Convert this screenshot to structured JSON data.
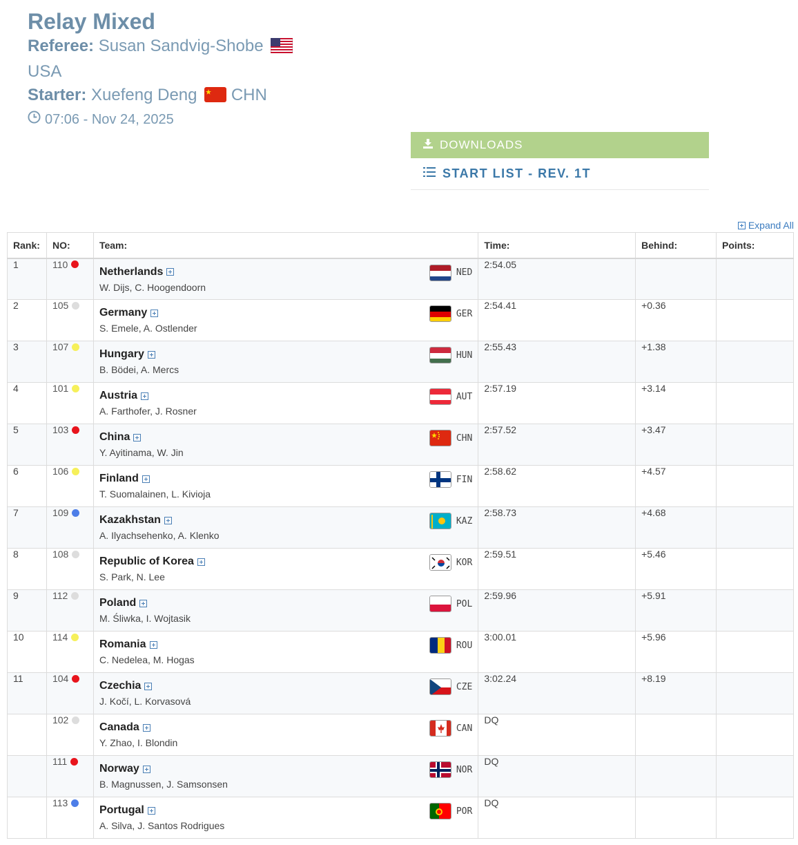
{
  "event": {
    "title": "Relay Mixed",
    "referee_label": "Referee:",
    "referee_name": "Susan Sandvig-Shobe",
    "referee_country": "USA",
    "starter_label": "Starter:",
    "starter_name": "Xuefeng Deng",
    "starter_country": "CHN",
    "datetime": "07:06 - Nov 24, 2025"
  },
  "downloads": {
    "header": "DOWNLOADS",
    "items": [
      {
        "label": "START LIST - REV. 1T"
      }
    ]
  },
  "expand_all": "Expand All",
  "table": {
    "headers": {
      "rank": "Rank:",
      "no": "NO:",
      "team": "Team:",
      "time": "Time:",
      "behind": "Behind:",
      "points": "Points:"
    },
    "rows": [
      {
        "rank": "1",
        "no": "110",
        "dot": "#e8141c",
        "team": "Netherlands",
        "members": "W. Dijs, C. Hoogendoorn",
        "code": "NED",
        "time": "2:54.05",
        "behind": "",
        "points": ""
      },
      {
        "rank": "2",
        "no": "105",
        "dot": "#dddddd",
        "team": "Germany",
        "members": "S. Emele, A. Ostlender",
        "code": "GER",
        "time": "2:54.41",
        "behind": "+0.36",
        "points": ""
      },
      {
        "rank": "3",
        "no": "107",
        "dot": "#f6f05a",
        "team": "Hungary",
        "members": "B. Bödei, A. Mercs",
        "code": "HUN",
        "time": "2:55.43",
        "behind": "+1.38",
        "points": ""
      },
      {
        "rank": "4",
        "no": "101",
        "dot": "#f6f05a",
        "team": "Austria",
        "members": "A. Farthofer, J. Rosner",
        "code": "AUT",
        "time": "2:57.19",
        "behind": "+3.14",
        "points": ""
      },
      {
        "rank": "5",
        "no": "103",
        "dot": "#e8141c",
        "team": "China",
        "members": "Y. Ayitinama, W. Jin",
        "code": "CHN",
        "time": "2:57.52",
        "behind": "+3.47",
        "points": ""
      },
      {
        "rank": "6",
        "no": "106",
        "dot": "#f6f05a",
        "team": "Finland",
        "members": "T. Suomalainen, L. Kivioja",
        "code": "FIN",
        "time": "2:58.62",
        "behind": "+4.57",
        "points": ""
      },
      {
        "rank": "7",
        "no": "109",
        "dot": "#4d7ee8",
        "team": "Kazakhstan",
        "members": "A. Ilyachsehenko, A. Klenko",
        "code": "KAZ",
        "time": "2:58.73",
        "behind": "+4.68",
        "points": ""
      },
      {
        "rank": "8",
        "no": "108",
        "dot": "#dddddd",
        "team": "Republic of Korea",
        "members": "S. Park, N. Lee",
        "code": "KOR",
        "time": "2:59.51",
        "behind": "+5.46",
        "points": ""
      },
      {
        "rank": "9",
        "no": "112",
        "dot": "#dddddd",
        "team": "Poland",
        "members": "M. Śliwka, I. Wojtasik",
        "code": "POL",
        "time": "2:59.96",
        "behind": "+5.91",
        "points": ""
      },
      {
        "rank": "10",
        "no": "114",
        "dot": "#f6f05a",
        "team": "Romania",
        "members": "C. Nedelea, M. Hogas",
        "code": "ROU",
        "time": "3:00.01",
        "behind": "+5.96",
        "points": ""
      },
      {
        "rank": "11",
        "no": "104",
        "dot": "#e8141c",
        "team": "Czechia",
        "members": "J. Kočí, L. Korvasová",
        "code": "CZE",
        "time": "3:02.24",
        "behind": "+8.19",
        "points": ""
      },
      {
        "rank": "",
        "no": "102",
        "dot": "#dddddd",
        "team": "Canada",
        "members": "Y. Zhao, I. Blondin",
        "code": "CAN",
        "time": "DQ",
        "behind": "",
        "points": ""
      },
      {
        "rank": "",
        "no": "111",
        "dot": "#e8141c",
        "team": "Norway",
        "members": "B. Magnussen, J. Samsonsen",
        "code": "NOR",
        "time": "DQ",
        "behind": "",
        "points": ""
      },
      {
        "rank": "",
        "no": "113",
        "dot": "#4d7ee8",
        "team": "Portugal",
        "members": "A. Silva, J. Santos Rodrigues",
        "code": "POR",
        "time": "DQ",
        "behind": "",
        "points": ""
      }
    ]
  }
}
